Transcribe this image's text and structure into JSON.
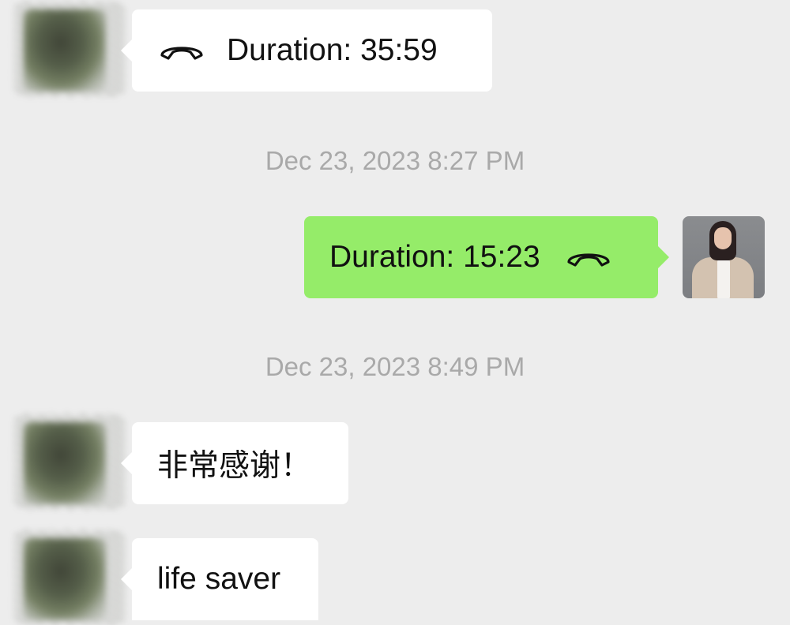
{
  "messages": [
    {
      "type": "call",
      "direction": "incoming",
      "text": "Duration: 35:59",
      "icon": "phone-hangup-icon"
    },
    {
      "type": "timestamp",
      "text": "Dec 23, 2023 8:27 PM"
    },
    {
      "type": "call",
      "direction": "outgoing",
      "text": "Duration: 15:23",
      "icon": "phone-hangup-icon"
    },
    {
      "type": "timestamp",
      "text": "Dec 23, 2023 8:49 PM"
    },
    {
      "type": "text",
      "direction": "incoming",
      "text": "非常感谢！"
    },
    {
      "type": "text",
      "direction": "incoming",
      "text": "life saver"
    }
  ],
  "colors": {
    "background": "#ededed",
    "incoming_bubble": "#ffffff",
    "outgoing_bubble": "#95ec69",
    "timestamp_text": "#a9a9a9"
  }
}
